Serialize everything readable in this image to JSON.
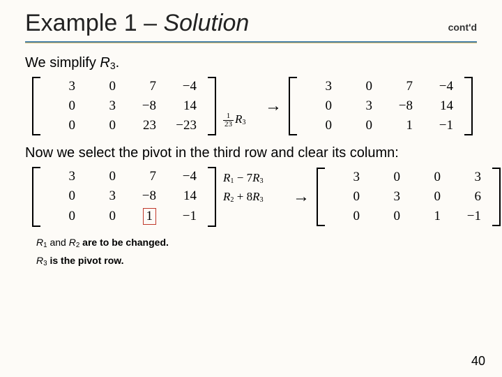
{
  "header": {
    "title_prefix": "Example 1 – ",
    "title_italic": "Solution",
    "contd": "cont'd"
  },
  "body": {
    "p1_a": "We simplify ",
    "p1_R": "R",
    "p1_sub": "3",
    "p1_dot": ".",
    "p2": "Now we select the pivot in the third row and clear its column:"
  },
  "mat1_left": {
    "r0c0": "3",
    "r0c1": "0",
    "r0c2": "7",
    "r0c3": "−4",
    "r1c0": "0",
    "r1c1": "3",
    "r1c2": "−8",
    "r1c3": "14",
    "r2c0": "0",
    "r2c1": "0",
    "r2c2": "23",
    "r2c3": "−23"
  },
  "op1": {
    "frac_num": "1",
    "frac_den": "23",
    "R": "R",
    "sub": "3"
  },
  "mat1_right": {
    "r0c0": "3",
    "r0c1": "0",
    "r0c2": "7",
    "r0c3": "−4",
    "r1c0": "0",
    "r1c1": "3",
    "r1c2": "−8",
    "r1c3": "14",
    "r2c0": "0",
    "r2c1": "0",
    "r2c2": "1",
    "r2c3": "−1"
  },
  "mat2_left": {
    "r0c0": "3",
    "r0c1": "0",
    "r0c2": "7",
    "r0c3": "−4",
    "r1c0": "0",
    "r1c1": "3",
    "r1c2": "−8",
    "r1c3": "14",
    "r2c0": "0",
    "r2c1": "0",
    "r2c2": "1",
    "r2c3": "−1"
  },
  "op2": {
    "row0_a": "R",
    "row0_sub": "1",
    "row0_b": " − 7",
    "row0_R2": "R",
    "row0_sub2": "3",
    "row1_a": "R",
    "row1_sub": "2",
    "row1_b": " + 8",
    "row1_R2": "R",
    "row1_sub2": "3"
  },
  "mat2_right": {
    "r0c0": "3",
    "r0c1": "0",
    "r0c2": "0",
    "r0c3": "3",
    "r1c0": "0",
    "r1c1": "3",
    "r1c2": "0",
    "r1c3": "6",
    "r2c0": "0",
    "r2c1": "0",
    "r2c2": "1",
    "r2c3": "−1"
  },
  "notes": {
    "n1_a": "R",
    "n1_s1": "1",
    "n1_b": " and ",
    "n1_c": "R",
    "n1_s2": "2",
    "n1_suffix": " are to be changed.",
    "n2_a": "R",
    "n2_s1": "3",
    "n2_suffix": " is the pivot row."
  },
  "arrow": "→",
  "period": ".",
  "slidenum": "40"
}
